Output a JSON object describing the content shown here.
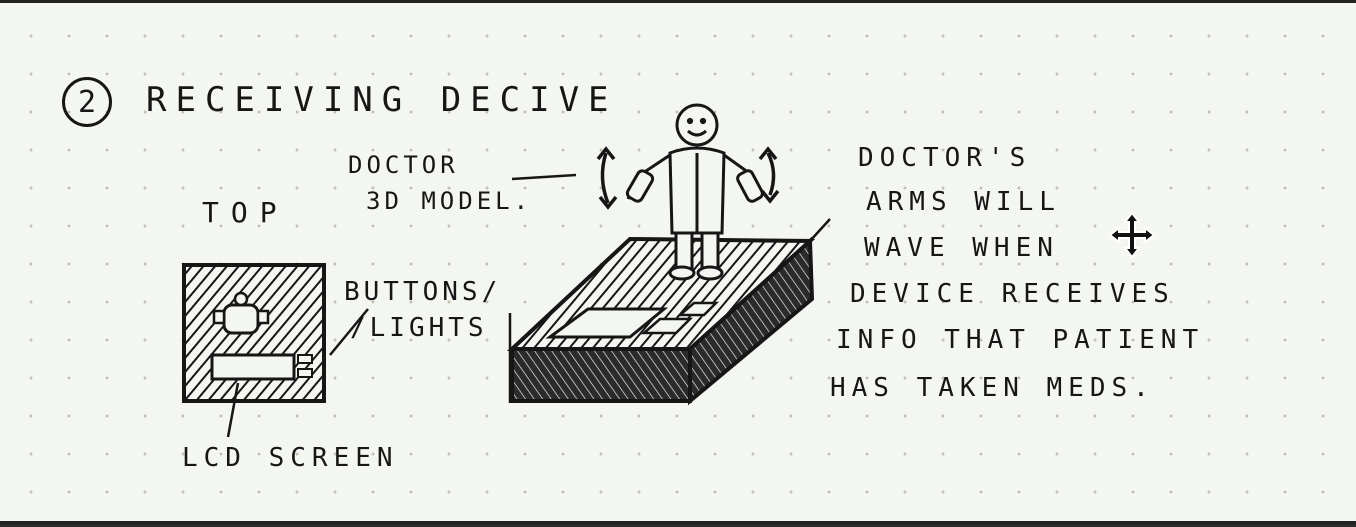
{
  "title": {
    "number": "2",
    "text": "RECEIVING DECIVE"
  },
  "labels": {
    "top": "TOP",
    "doctor_line1": "DOCTOR",
    "doctor_line2": "3D MODEL.",
    "buttons_line1": "BUTTONS/",
    "buttons_line2": "/LIGHTS",
    "lcd": "LCD SCREEN"
  },
  "note_lines": [
    "DOCTOR'S",
    "ARMS  WILL",
    "WAVE  WHEN",
    "DEVICE RECEIVES",
    "INFO  THAT  PATIENT",
    "HAS  TAKEN  MEDS."
  ],
  "colors": {
    "ink": "#161616",
    "paper": "#f3f6f1",
    "dots": "#c6beb0"
  },
  "icons": [
    "move-cursor-icon",
    "wave-arrow-icon",
    "doctor-figure-icon"
  ]
}
